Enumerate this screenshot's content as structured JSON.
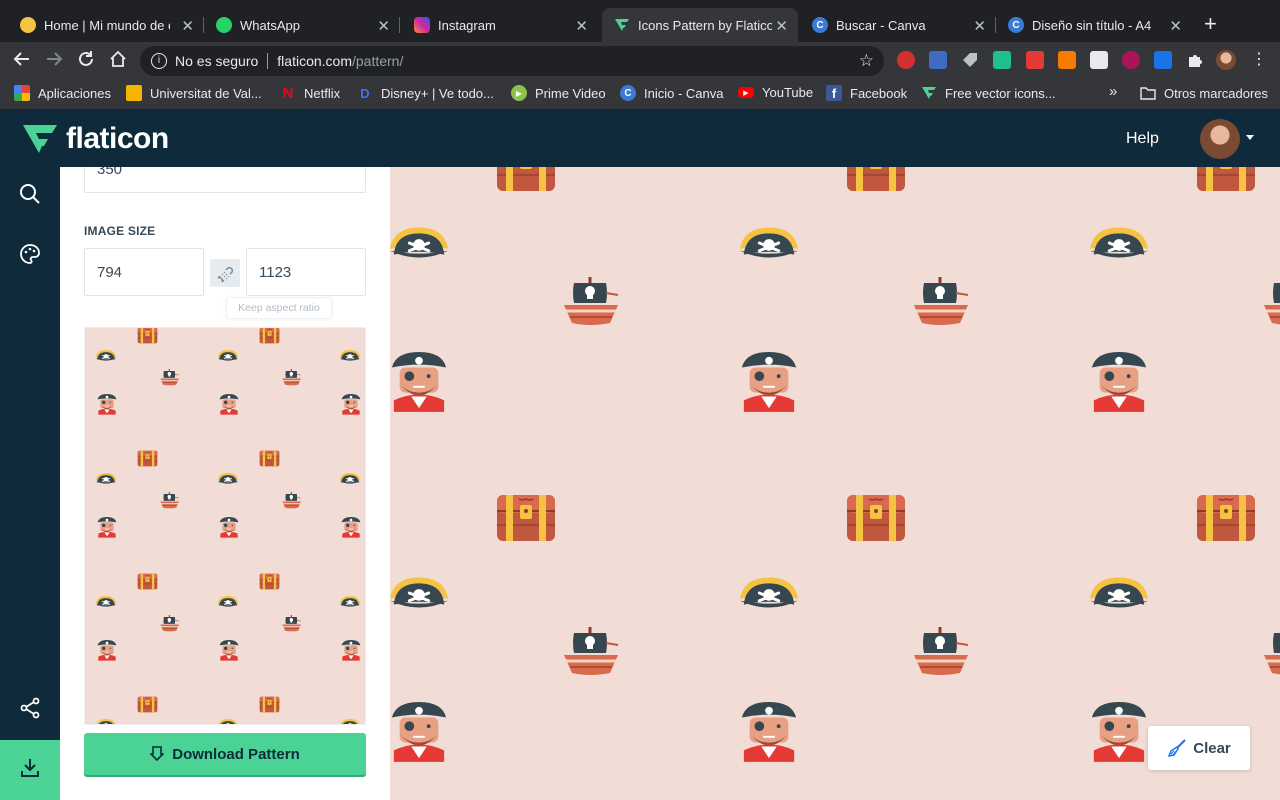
{
  "browser": {
    "tabs": [
      {
        "title": "Home | Mi mundo de ex",
        "favicon": "emoji-icon",
        "color": "#f4c542",
        "glyph": ""
      },
      {
        "title": "WhatsApp",
        "favicon": "whatsapp-icon",
        "color": "#25d366",
        "glyph": ""
      },
      {
        "title": "Instagram",
        "favicon": "instagram-icon",
        "color": "#d6249f",
        "glyph": ""
      },
      {
        "title": "Icons Pattern by Flatico",
        "favicon": "flaticon-icon",
        "color": "#4ad395",
        "glyph": ""
      },
      {
        "title": "Buscar - Canva",
        "favicon": "canva-icon",
        "color": "#3a7bd5",
        "glyph": "C"
      },
      {
        "title": "Diseño sin título - A4",
        "favicon": "canva-icon",
        "color": "#3a7bd5",
        "glyph": "C"
      }
    ],
    "url_insecure": "No es seguro",
    "url_host": "flaticon.com",
    "url_path": "/pattern/",
    "bookmarks": [
      {
        "label": "Aplicaciones",
        "icon": "apps-grid-icon",
        "color": "#ea4335",
        "glyph": ""
      },
      {
        "label": "Universitat de Val...",
        "icon": "university-icon",
        "color": "#f4b400",
        "glyph": ""
      },
      {
        "label": "Netflix",
        "icon": "netflix-icon",
        "color": "#202124",
        "glyph": "N"
      },
      {
        "label": "Disney+ | Ve todo...",
        "icon": "disney-icon",
        "color": "#1a3fb5",
        "glyph": "D"
      },
      {
        "label": "Prime Video",
        "icon": "play-icon",
        "color": "#8bc34a",
        "glyph": "▶"
      },
      {
        "label": "Inicio - Canva",
        "icon": "canva-icon",
        "color": "#3a7bd5",
        "glyph": "C"
      },
      {
        "label": "YouTube",
        "icon": "youtube-icon",
        "color": "#ff0000",
        "glyph": "▶"
      },
      {
        "label": "Facebook",
        "icon": "facebook-icon",
        "color": "#3b5998",
        "glyph": "f"
      },
      {
        "label": "Free vector icons...",
        "icon": "flaticon-icon",
        "color": "#4ad395",
        "glyph": ""
      }
    ],
    "bookmarks_more": "»",
    "other_bookmarks": "Otros marcadores"
  },
  "header": {
    "logo_text": "flaticon",
    "help_label": "Help"
  },
  "panel": {
    "top_value": "350",
    "image_size_label": "IMAGE SIZE",
    "width_value": "794",
    "height_value": "1123",
    "aspect_tooltip": "Keep aspect ratio",
    "download_label": "Download Pattern"
  },
  "canvas": {
    "clear_label": "Clear",
    "background": "#f1dcd6"
  },
  "colors": {
    "brand": "#4ad395",
    "navy": "#0e2a3b"
  }
}
